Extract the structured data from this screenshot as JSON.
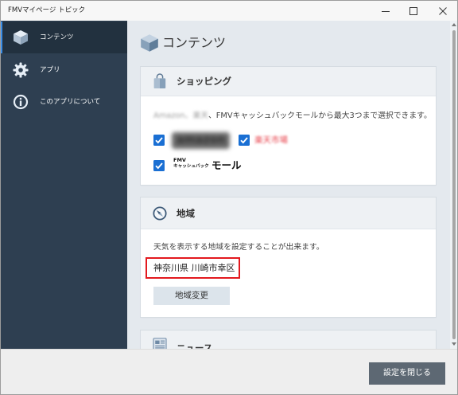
{
  "window": {
    "title": "FMVマイページ トピック",
    "minimize_icon": "minimize-icon",
    "maximize_icon": "maximize-icon",
    "close_icon": "close-icon"
  },
  "sidebar": {
    "items": [
      {
        "label": "コンテンツ",
        "icon": "cube-icon",
        "selected": true
      },
      {
        "label": "アプリ",
        "icon": "gear-icon",
        "selected": false
      },
      {
        "label": "このアプリについて",
        "icon": "info-icon",
        "selected": false
      }
    ]
  },
  "main": {
    "title": "コンテンツ",
    "title_icon": "cube-icon",
    "shopping": {
      "title": "ショッピング",
      "icon": "shopping-bag-icon",
      "description_blurred": "Amazon、楽天",
      "description": "、FMVキャッシュバックモールから最大3つまで選択できます。",
      "options": [
        {
          "label": "amazon",
          "checked": true,
          "blurred": true
        },
        {
          "label": "楽天市場",
          "checked": true,
          "blurred": true
        },
        {
          "label_brand": "FMV",
          "label_sub": "キャッシュバック",
          "label_main": "モール",
          "checked": true
        }
      ]
    },
    "region": {
      "title": "地域",
      "icon": "compass-icon",
      "description": "天気を表示する地域を設定することが出来ます。",
      "value": "神奈川県 川崎市幸区",
      "change_button": "地域変更"
    },
    "news": {
      "title": "ニュース",
      "icon": "news-icon"
    }
  },
  "footer": {
    "close_button": "設定を閉じる"
  },
  "colors": {
    "sidebar_bg": "#2e3f51",
    "sidebar_selected_bg": "#22313f",
    "accent": "#3b8fe8",
    "main_bg": "#e4e9ee",
    "card_header_bg": "#eef1f4",
    "checkbox": "#1a6fd3",
    "highlight_border": "#e3191e",
    "button_dark": "#5d6873",
    "button_light": "#dce4eb",
    "footer_bg": "#eeeeee",
    "titlebar_bg": "#f7f7f7",
    "icon_blue": "#6f8aa6",
    "logo_red": "#e8404a"
  }
}
